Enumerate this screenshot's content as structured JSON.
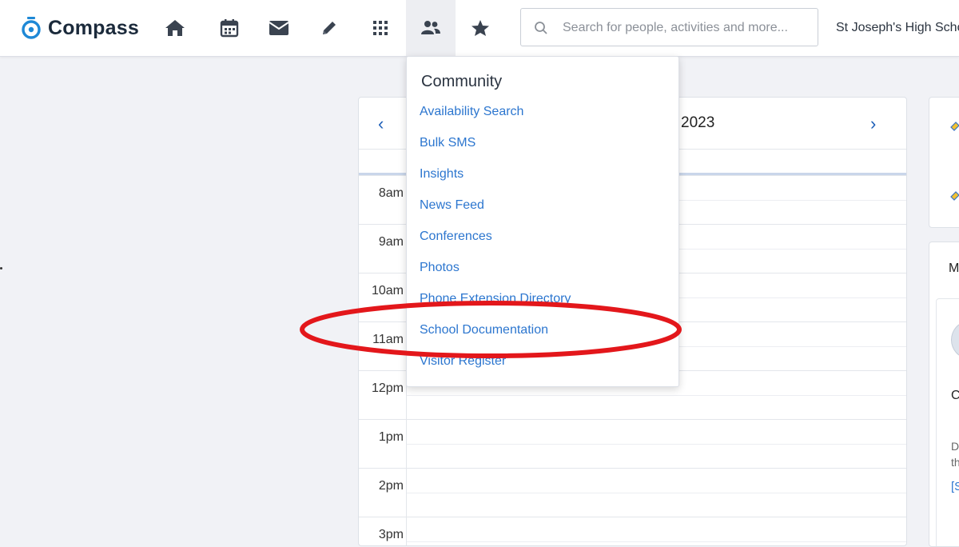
{
  "app": {
    "name": "Compass"
  },
  "topbar": {
    "nav_icons": [
      "home-icon",
      "calendar-icon",
      "mail-icon",
      "pencil-icon",
      "grid-icon",
      "people-icon",
      "star-icon"
    ],
    "active_nav": "people-icon",
    "search": {
      "placeholder": "Search for people, activities and more..."
    },
    "school_name": "St Joseph's High Scho"
  },
  "calendar": {
    "title_fragment": "2023",
    "prev": "‹",
    "next": "›",
    "hours": [
      "8am",
      "9am",
      "10am",
      "11am",
      "12pm",
      "1pm",
      "2pm",
      "3pm"
    ]
  },
  "dropdown": {
    "heading": "Community",
    "items": [
      "Availability Search",
      "Bulk SMS",
      "Insights",
      "News Feed",
      "Conferences",
      "Photos",
      "Phone Extension Directory",
      "School Documentation",
      "Visitor Register"
    ],
    "highlighted_item": "School Documentation"
  },
  "side_panel": {
    "card2_letter": "M",
    "fragments": [
      "C",
      "D",
      "th",
      "[S"
    ]
  },
  "colors": {
    "accent": "#1e88d6",
    "link": "#2c76cf",
    "highlight": "#e3171b"
  }
}
